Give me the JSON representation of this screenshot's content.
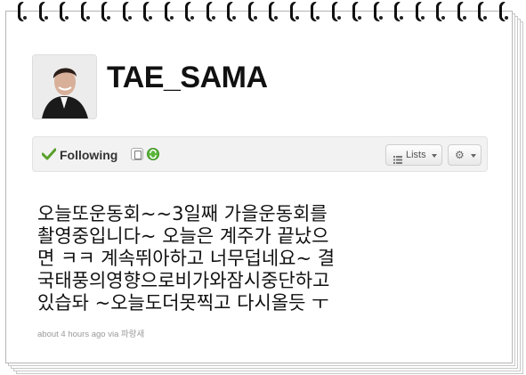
{
  "profile": {
    "username": "TAE_SAMA"
  },
  "actions": {
    "following_label": "Following",
    "lists_label": "Lists"
  },
  "tweet": {
    "text": "오늘또운동회~~3일째 가을운동회를\n촬영중입니다~ 오늘은 계주가 끝났으\n면 ㅋㅋ 계속뛰아하고 너무덥네요~ 결\n국태풍의영향으로비가와잠시중단하고\n있습돠 ~오늘도더못찍고 다시올듯 ㅜ",
    "meta": "about 4 hours ago via 파랑새"
  },
  "icons": {
    "follow_check": "check-icon",
    "device": "device-notification-icon",
    "retweet": "retweet-toggle-icon",
    "lists": "list-icon",
    "settings": "gear-icon"
  },
  "colors": {
    "check_green": "#5aa02c",
    "retweet_green": "#5ab63a",
    "username": "#111111",
    "meta_text": "#999999"
  }
}
